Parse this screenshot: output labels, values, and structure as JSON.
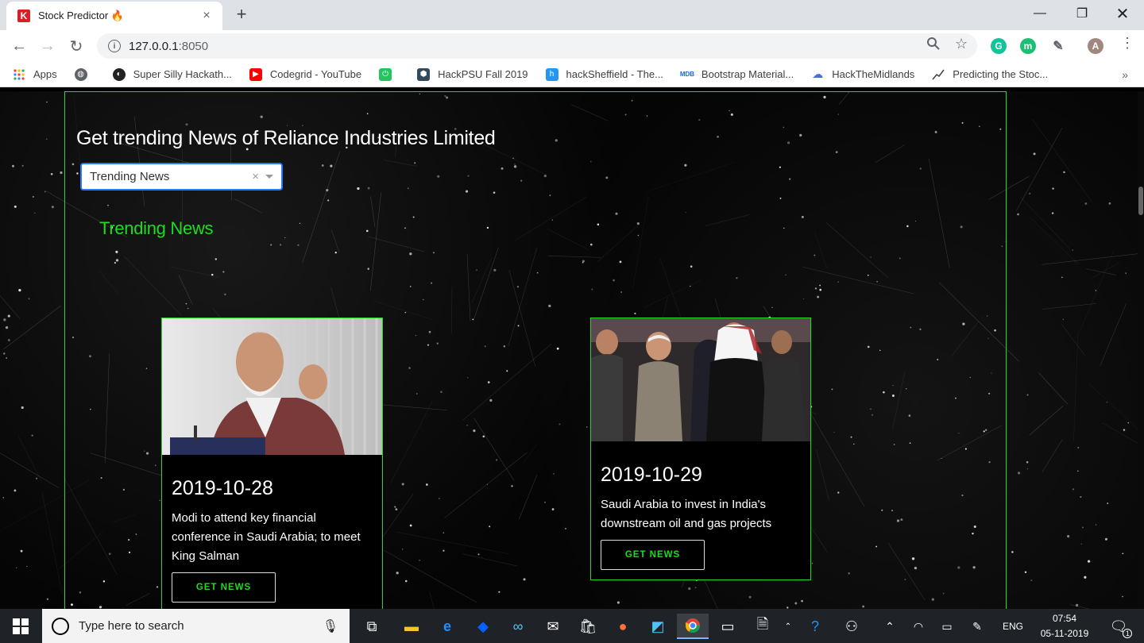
{
  "browser": {
    "tab_title": "Stock Predictor 🔥",
    "favicon_letter": "K",
    "tab_close": "×",
    "new_tab": "+",
    "url_host": "127.0.0.1",
    "url_port": ":8050",
    "bookmarks": [
      {
        "label": "Apps",
        "icon": "apps-grid-icon"
      },
      {
        "label": "",
        "icon": "globe-icon"
      },
      {
        "label": "Super Silly Hackath...",
        "icon": "hackathon-icon"
      },
      {
        "label": "Codegrid - YouTube",
        "icon": "youtube-icon"
      },
      {
        "label": "",
        "icon": "power-icon"
      },
      {
        "label": "HackPSU Fall 2019",
        "icon": "hackpsu-icon"
      },
      {
        "label": "hackSheffield - The...",
        "icon": "hacksheffield-icon"
      },
      {
        "label": "Bootstrap Material...",
        "icon": "mdb-icon"
      },
      {
        "label": "HackTheMidlands",
        "icon": "cloud-icon"
      },
      {
        "label": "Predicting the Stoc...",
        "icon": "chart-line-icon"
      }
    ],
    "bookmarks_more": "»",
    "profile_letter": "A"
  },
  "page": {
    "heading": "Get trending News of Reliance Industries Limited",
    "dropdown": {
      "value": "Trending News",
      "clear": "×"
    },
    "section_title": "Trending News",
    "cards": [
      {
        "date": "2019-10-28",
        "description": "Modi to attend key financial conference in Saudi Arabia; to meet King Salman",
        "button": "GET NEWS"
      },
      {
        "date": "2019-10-29",
        "description": "Saudi Arabia to invest in India's downstream oil and gas projects",
        "button": "GET NEWS"
      }
    ]
  },
  "taskbar": {
    "search_placeholder": "Type here to search",
    "language": "ENG",
    "time": "07:54",
    "date": "05-11-2019",
    "notification_count": "1"
  },
  "colors": {
    "accent_green": "#1fdc1f",
    "dropdown_border": "#2979ff"
  }
}
